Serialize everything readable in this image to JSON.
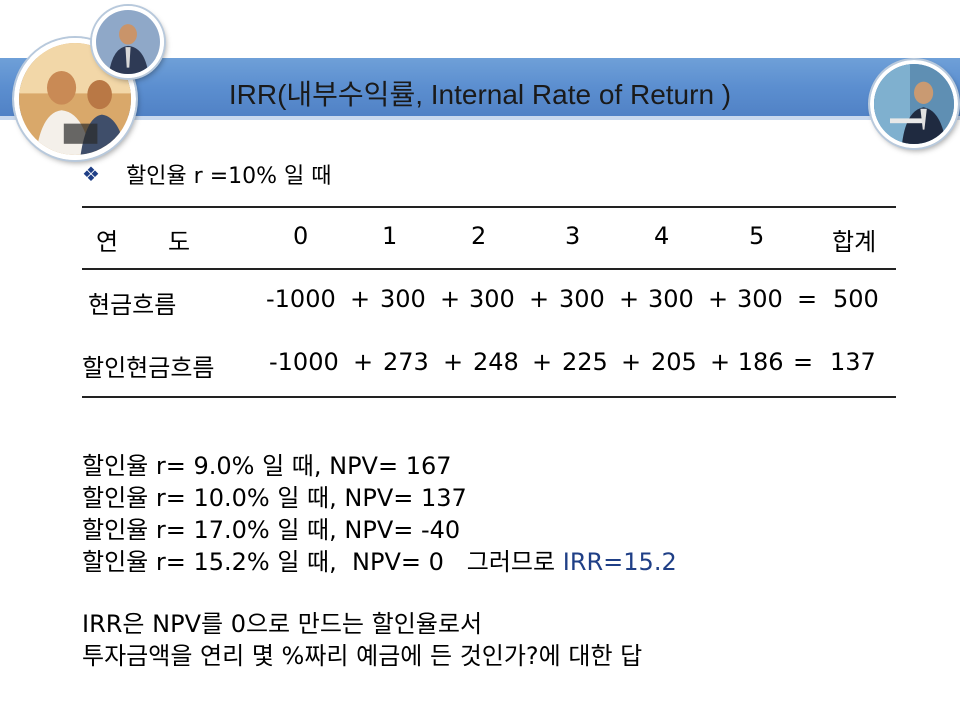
{
  "title": "IRR(내부수익률, Internal Rate of Return )",
  "bullet": {
    "icon": "diamond-bullet-icon",
    "text": "할인율 r =10% 일 때"
  },
  "table": {
    "header": [
      "연",
      "도",
      "0",
      "1",
      "2",
      "3",
      "4",
      "5",
      "합계"
    ],
    "rows": [
      {
        "label": "현금흐름",
        "values": [
          "-1000",
          "+",
          "300",
          "+",
          "300",
          "+",
          "300",
          "+",
          "300",
          "+",
          "300",
          "=",
          "500"
        ]
      },
      {
        "label": "할인현금흐름",
        "values": [
          "-1000",
          "+",
          "273",
          "+",
          "248",
          "+",
          "225",
          "+",
          "205",
          "+ 186",
          "=",
          "137"
        ]
      }
    ]
  },
  "npv_lines": [
    "할인율 r= 9.0% 일 때,  NPV= 167",
    "할인율 r= 10.0% 일 때,  NPV= 137",
    "할인율 r= 17.0% 일 때,  NPV= -40",
    "할인율 r= 15.2% 일 때,  NPV= 0   그러므로"
  ],
  "irr_result": "IRR=15.2",
  "conclusion": [
    "IRR은 NPV를 0으로 만드는 할인율로서",
    "투자금액을 연리 몇 %짜리 예금에 든 것인가?에 대한 답"
  ],
  "colors": {
    "title_bar": "#5c8fd0",
    "accent": "#1f3f86"
  }
}
